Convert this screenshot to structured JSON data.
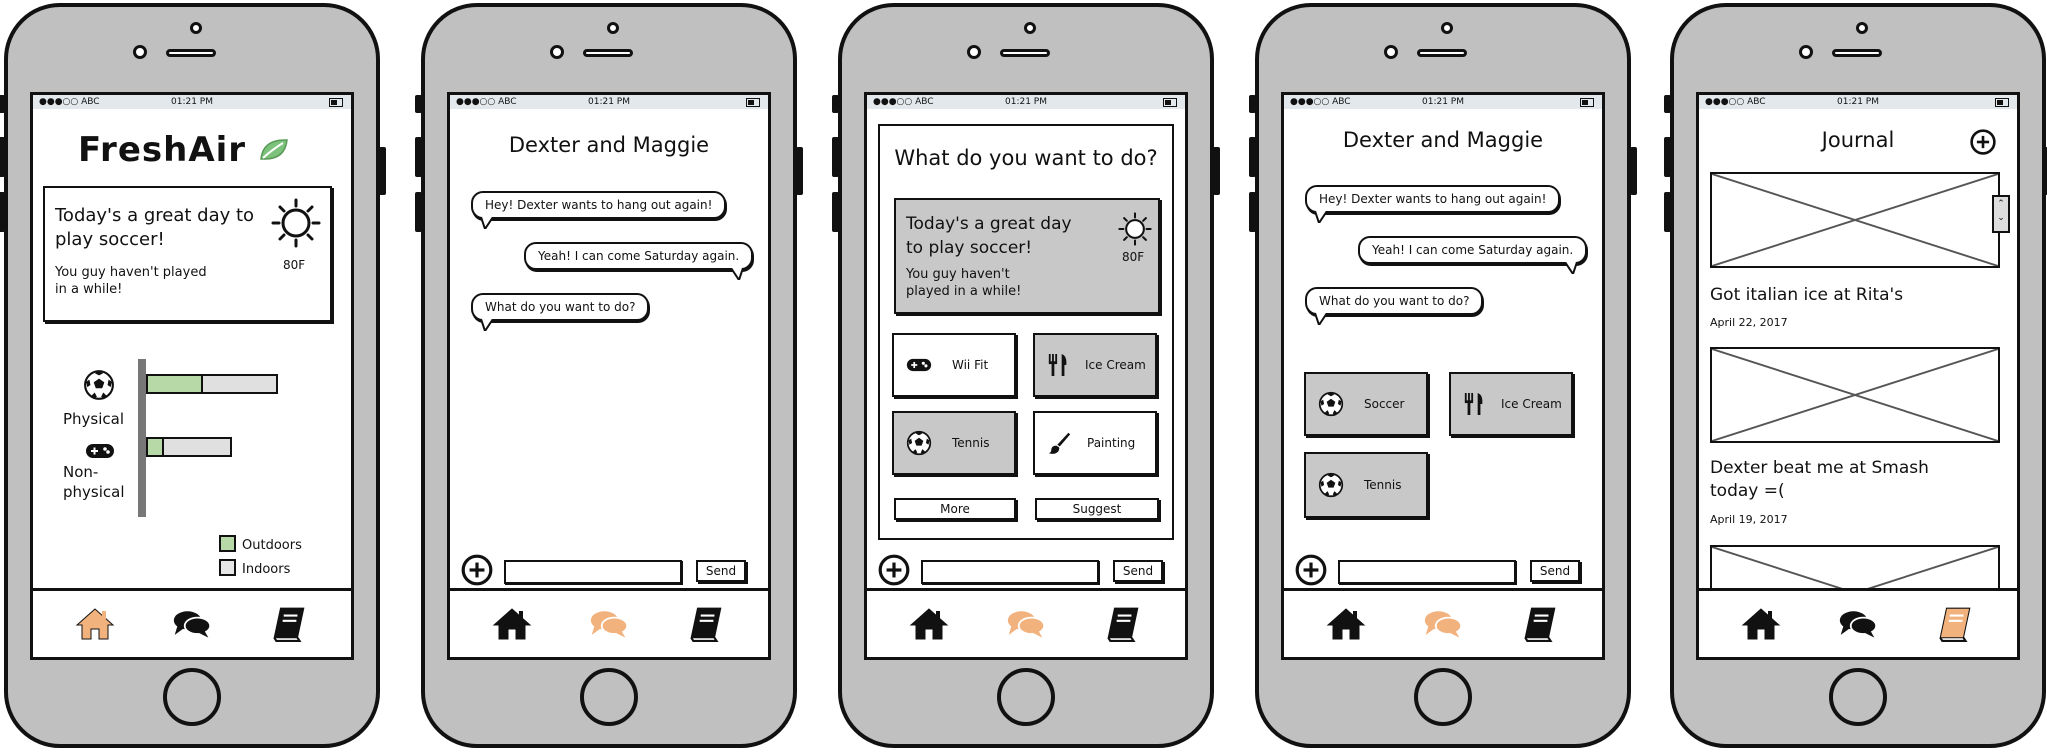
{
  "status": {
    "signal": "●●●○○ ABC",
    "time": "01:21 PM"
  },
  "colors": {
    "accent": "#f2b27e",
    "green": "#b7d9a8",
    "gray": "#c8c8c8",
    "leaf": "#7cc27a"
  },
  "screen1": {
    "logo": "FreshAir",
    "weather": {
      "line1": "Today's a great day to",
      "line2": "play soccer!",
      "sub1": "You guy haven't played",
      "sub2": "in a while!",
      "temp": "80F"
    },
    "chart_data": {
      "type": "bar",
      "orientation": "horizontal",
      "stacked": true,
      "categories": [
        "Physical",
        "Non-physical"
      ],
      "category_lines": [
        [
          "Physical"
        ],
        [
          "Non-",
          "physical"
        ]
      ],
      "series": [
        {
          "name": "Outdoors",
          "values": [
            43,
            14
          ]
        },
        {
          "name": "Indoors",
          "values": [
            57,
            51
          ]
        }
      ],
      "legend": [
        "Outdoors",
        "Indoors"
      ],
      "legend_position": "bottom-right"
    }
  },
  "screen2": {
    "title": "Dexter and Maggie",
    "messages": [
      "Hey! Dexter wants to hang out again!",
      "Yeah! I can come Saturday again.",
      "What do you want to do?"
    ],
    "send": "Send"
  },
  "screen3": {
    "title": "What do you want to do?",
    "weather": {
      "line1": "Today's a great day",
      "line2": "to play soccer!",
      "sub1": "You guy haven't",
      "sub2": "played in a while!",
      "temp": "80F"
    },
    "options": [
      "Wii Fit",
      "Ice Cream",
      "Tennis",
      "Painting"
    ],
    "more": "More",
    "suggest": "Suggest",
    "send": "Send"
  },
  "screen4": {
    "title": "Dexter and Maggie",
    "messages": [
      "Hey! Dexter wants to hang out again!",
      "Yeah! I can come Saturday again.",
      "What do you want to do?"
    ],
    "choices": [
      "Soccer",
      "Ice Cream",
      "Tennis"
    ],
    "send": "Send"
  },
  "screen5": {
    "title": "Journal",
    "entries": [
      {
        "title": "Got italian ice at Rita's",
        "date": "April 22, 2017"
      },
      {
        "title_line1": "Dexter beat me at Smash",
        "title_line2": "today =(",
        "date": "April 19, 2017"
      }
    ]
  },
  "icons": {
    "home": "home-icon",
    "chat": "chat-icon",
    "journal": "journal-icon"
  }
}
